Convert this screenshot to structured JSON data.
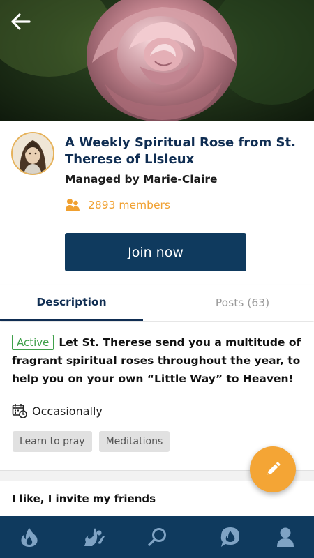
{
  "header": {
    "back_icon": "arrow-left-icon",
    "hero_image": "pink-rose-photo"
  },
  "group": {
    "title": "A Weekly Spiritual Rose from St. Therese of Lisieux",
    "managed_by": "Managed by Marie-Claire",
    "members": "2893 members",
    "members_icon": "people-icon",
    "join_label": "Join now",
    "avatar": "st-therese-portrait"
  },
  "tabs": {
    "description": "Description",
    "posts": "Posts (63)"
  },
  "description": {
    "status": "Active",
    "text": "Let St. Therese send you a multitude of fragrant spiritual roses throughout the year, to help you on your own “Little Way” to Heaven!",
    "frequency": "Occasionally",
    "frequency_icon": "calendar-clock-icon",
    "tags": [
      "Learn to pray",
      "Meditations"
    ]
  },
  "invite": {
    "label": "I like, I invite my friends"
  },
  "fab": {
    "icon": "pencil-icon"
  },
  "bottom_nav": {
    "items": [
      "flame-icon",
      "praying-hands-icon",
      "search-icon",
      "chat-flame-icon",
      "profile-icon"
    ]
  },
  "colors": {
    "primary": "#0f3a5e",
    "title": "#0f2d52",
    "accent": "#f4a535",
    "members": "#f0a030",
    "active": "#3fa04a"
  }
}
